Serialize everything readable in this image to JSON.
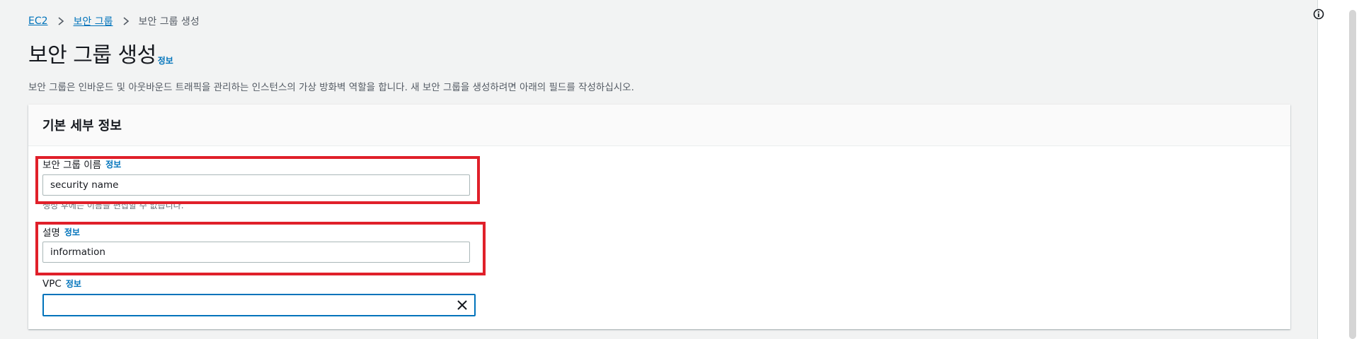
{
  "breadcrumb": {
    "items": [
      {
        "label": "EC2"
      },
      {
        "label": "보안 그룹"
      },
      {
        "label": "보안 그룹 생성"
      }
    ]
  },
  "header": {
    "title": "보안 그룹 생성",
    "info": "정보",
    "description": "보안 그룹은 인바운드 및 아웃바운드 트래픽을 관리하는 인스턴스의 가상 방화벽 역할을 합니다. 새 보안 그룹을 생성하려면 아래의 필드를 작성하십시오."
  },
  "panel": {
    "title": "기본 세부 정보",
    "fields": {
      "name": {
        "label": "보안 그룹 이름",
        "info": "정보",
        "value": "security name",
        "constraint": "생성 후에는 이름을 편집할 수 없습니다."
      },
      "description": {
        "label": "설명",
        "info": "정보",
        "value": "information"
      },
      "vpc": {
        "label": "VPC",
        "info": "정보",
        "value": ""
      }
    }
  },
  "icons": {
    "breadcrumb_separator": "chevron-right-icon",
    "clear": "close-icon",
    "help": "info-circle-icon"
  },
  "colors": {
    "link": "#0073bb",
    "highlight": "#e0202a",
    "focus_border": "#0073bb"
  }
}
